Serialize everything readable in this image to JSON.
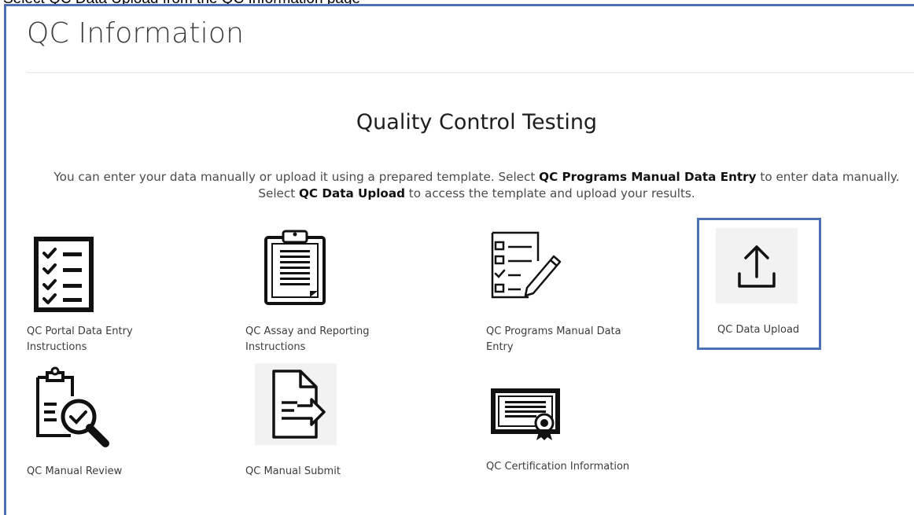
{
  "caption": "Select QC Data Upload from the QC Information page",
  "page": {
    "title": "QC Information"
  },
  "section": {
    "heading": "Quality Control Testing",
    "intro_part1": "You can enter your data manually or upload it using a prepared template. Select ",
    "intro_bold1": "QC Programs Manual Data Entry",
    "intro_part2": " to enter data manually. Select ",
    "intro_bold2": "QC Data Upload",
    "intro_part3": " to access the template and upload your results."
  },
  "tiles": [
    {
      "label": "QC Portal Data Entry Instructions",
      "icon": "checklist-icon"
    },
    {
      "label": "QC Assay and Reporting Instructions",
      "icon": "clipboard-icon"
    },
    {
      "label": "QC Programs Manual Data Entry",
      "icon": "form-pencil-icon"
    },
    {
      "label": "QC Data Upload",
      "icon": "upload-icon",
      "highlighted": true
    },
    {
      "label": "QC Manual Review",
      "icon": "clipboard-magnifier-icon"
    },
    {
      "label": "QC Manual Submit",
      "icon": "document-arrow-icon"
    },
    {
      "label": "QC Certification Information",
      "icon": "certificate-icon"
    }
  ],
  "colors": {
    "highlight_border": "#4a72b5",
    "icon_stroke": "#111111",
    "icon_background": "#f2f2f2"
  }
}
